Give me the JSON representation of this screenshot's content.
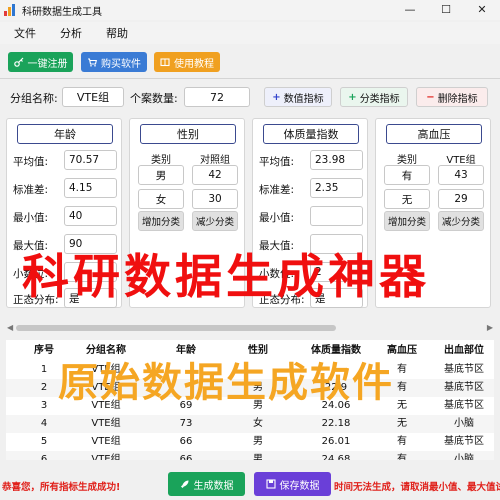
{
  "window": {
    "title": "科研数据生成工具",
    "minimize_glyph": "—",
    "maximize_glyph": "☐",
    "close_glyph": "✕"
  },
  "menu": [
    "文件",
    "分析",
    "帮助"
  ],
  "toolbar": {
    "register": {
      "label": "一键注册",
      "icon": "key-icon",
      "color": "#1aa35a"
    },
    "buy": {
      "label": "购买软件",
      "icon": "cart-icon",
      "color": "#3a7bd5"
    },
    "tutorial": {
      "label": "使用教程",
      "icon": "book-icon",
      "color": "#f0a020"
    }
  },
  "group": {
    "name_label": "分组名称:",
    "name_value": "VTE组",
    "count_label": "个案数量:",
    "count_value": "72",
    "add_numeric": "数值指标",
    "add_category": "分类指标",
    "delete_indicator": "删除指标",
    "plus_glyph": "+",
    "minus_glyph": "−"
  },
  "numeric_labels": {
    "mean": "平均值:",
    "sd": "标准差:",
    "min": "最小值:",
    "max": "最大值:",
    "decimals": "小数位:",
    "normal": "正态分布:"
  },
  "numeric_cards": [
    {
      "title": "年龄",
      "mean": "70.57",
      "sd": "4.15",
      "min": "40",
      "max": "90",
      "decimals": "",
      "normal": "是"
    },
    {
      "title": "体质量指数",
      "mean": "23.98",
      "sd": "2.35",
      "min": "",
      "max": "",
      "decimals": "2",
      "normal": "是"
    }
  ],
  "category_cards": [
    {
      "title": "性别",
      "col1": "类别",
      "col2": "对照组",
      "rows": [
        {
          "cat": "男",
          "val": "42"
        },
        {
          "cat": "女",
          "val": "30"
        }
      ],
      "add": "增加分类",
      "remove": "减少分类"
    },
    {
      "title": "高血压",
      "col1": "类别",
      "col2": "VTE组",
      "rows": [
        {
          "cat": "有",
          "val": "43"
        },
        {
          "cat": "无",
          "val": "29"
        }
      ],
      "add": "增加分类",
      "remove": "减少分类"
    }
  ],
  "table": {
    "headers": [
      "序号",
      "分组名称",
      "年龄",
      "性别",
      "体质量指数",
      "高血压",
      "出血部位"
    ],
    "rows": [
      [
        "1",
        "VTE组",
        "",
        "",
        "",
        "有",
        "基底节区"
      ],
      [
        "2",
        "VTE组",
        "",
        "男",
        "22.9",
        "有",
        "基底节区"
      ],
      [
        "3",
        "VTE组",
        "69",
        "男",
        "24.06",
        "无",
        "基底节区"
      ],
      [
        "4",
        "VTE组",
        "73",
        "女",
        "22.18",
        "无",
        "小脑"
      ],
      [
        "5",
        "VTE组",
        "66",
        "男",
        "26.01",
        "有",
        "基底节区"
      ],
      [
        "6",
        "VTE组",
        "66",
        "男",
        "24.68",
        "有",
        "小脑"
      ]
    ]
  },
  "footer": {
    "status_left": "恭喜您，所有指标生成成功!",
    "status_right": "时间无法生成，请取消最小值、最大值试试",
    "generate": "生成数据",
    "save": "保存数据",
    "generate_color": "#1aa35a",
    "save_color": "#6a3fd8"
  },
  "watermarks": {
    "line1": "科研数据生成神器",
    "line2": "原始数据生成软件"
  }
}
